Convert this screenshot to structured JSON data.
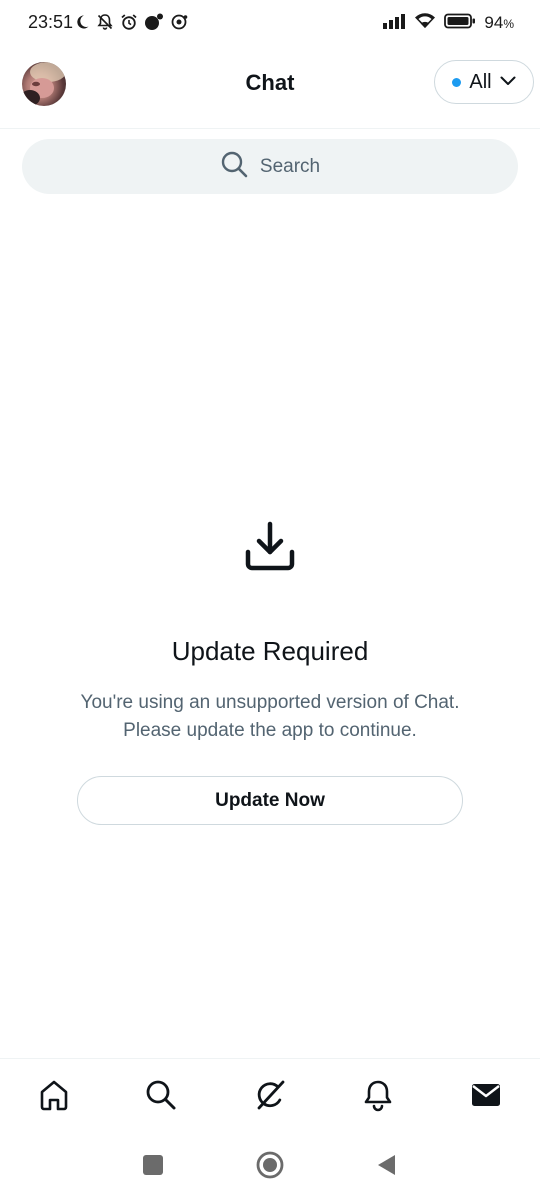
{
  "status_bar": {
    "time": "23:51",
    "battery_percent": "94",
    "battery_suffix": "%",
    "left_icons": [
      "moon-icon",
      "bell-off-icon",
      "alarm-icon",
      "notification-dot-icon",
      "record-icon"
    ],
    "right_icons": [
      "signal-icon",
      "wifi-icon",
      "battery-icon"
    ]
  },
  "header": {
    "title": "Chat",
    "filter_label": "All",
    "filter_dot_color": "#1d9bf0"
  },
  "search": {
    "placeholder": "Search"
  },
  "empty_state": {
    "icon": "download-icon",
    "title": "Update Required",
    "description": "You're using an unsupported version of Chat. Please update the app to continue.",
    "button_label": "Update Now"
  },
  "bottom_nav": {
    "items": [
      "home-icon",
      "search-icon",
      "grok-icon",
      "notifications-icon",
      "messages-icon"
    ],
    "active": "messages-icon"
  },
  "system_nav": {
    "items": [
      "recents-icon",
      "home-circle-icon",
      "back-icon"
    ]
  },
  "colors": {
    "accent": "#1d9bf0",
    "text_primary": "#0f1419",
    "text_secondary": "#536471",
    "border": "#cfd9de",
    "search_bg": "#eff3f4"
  }
}
